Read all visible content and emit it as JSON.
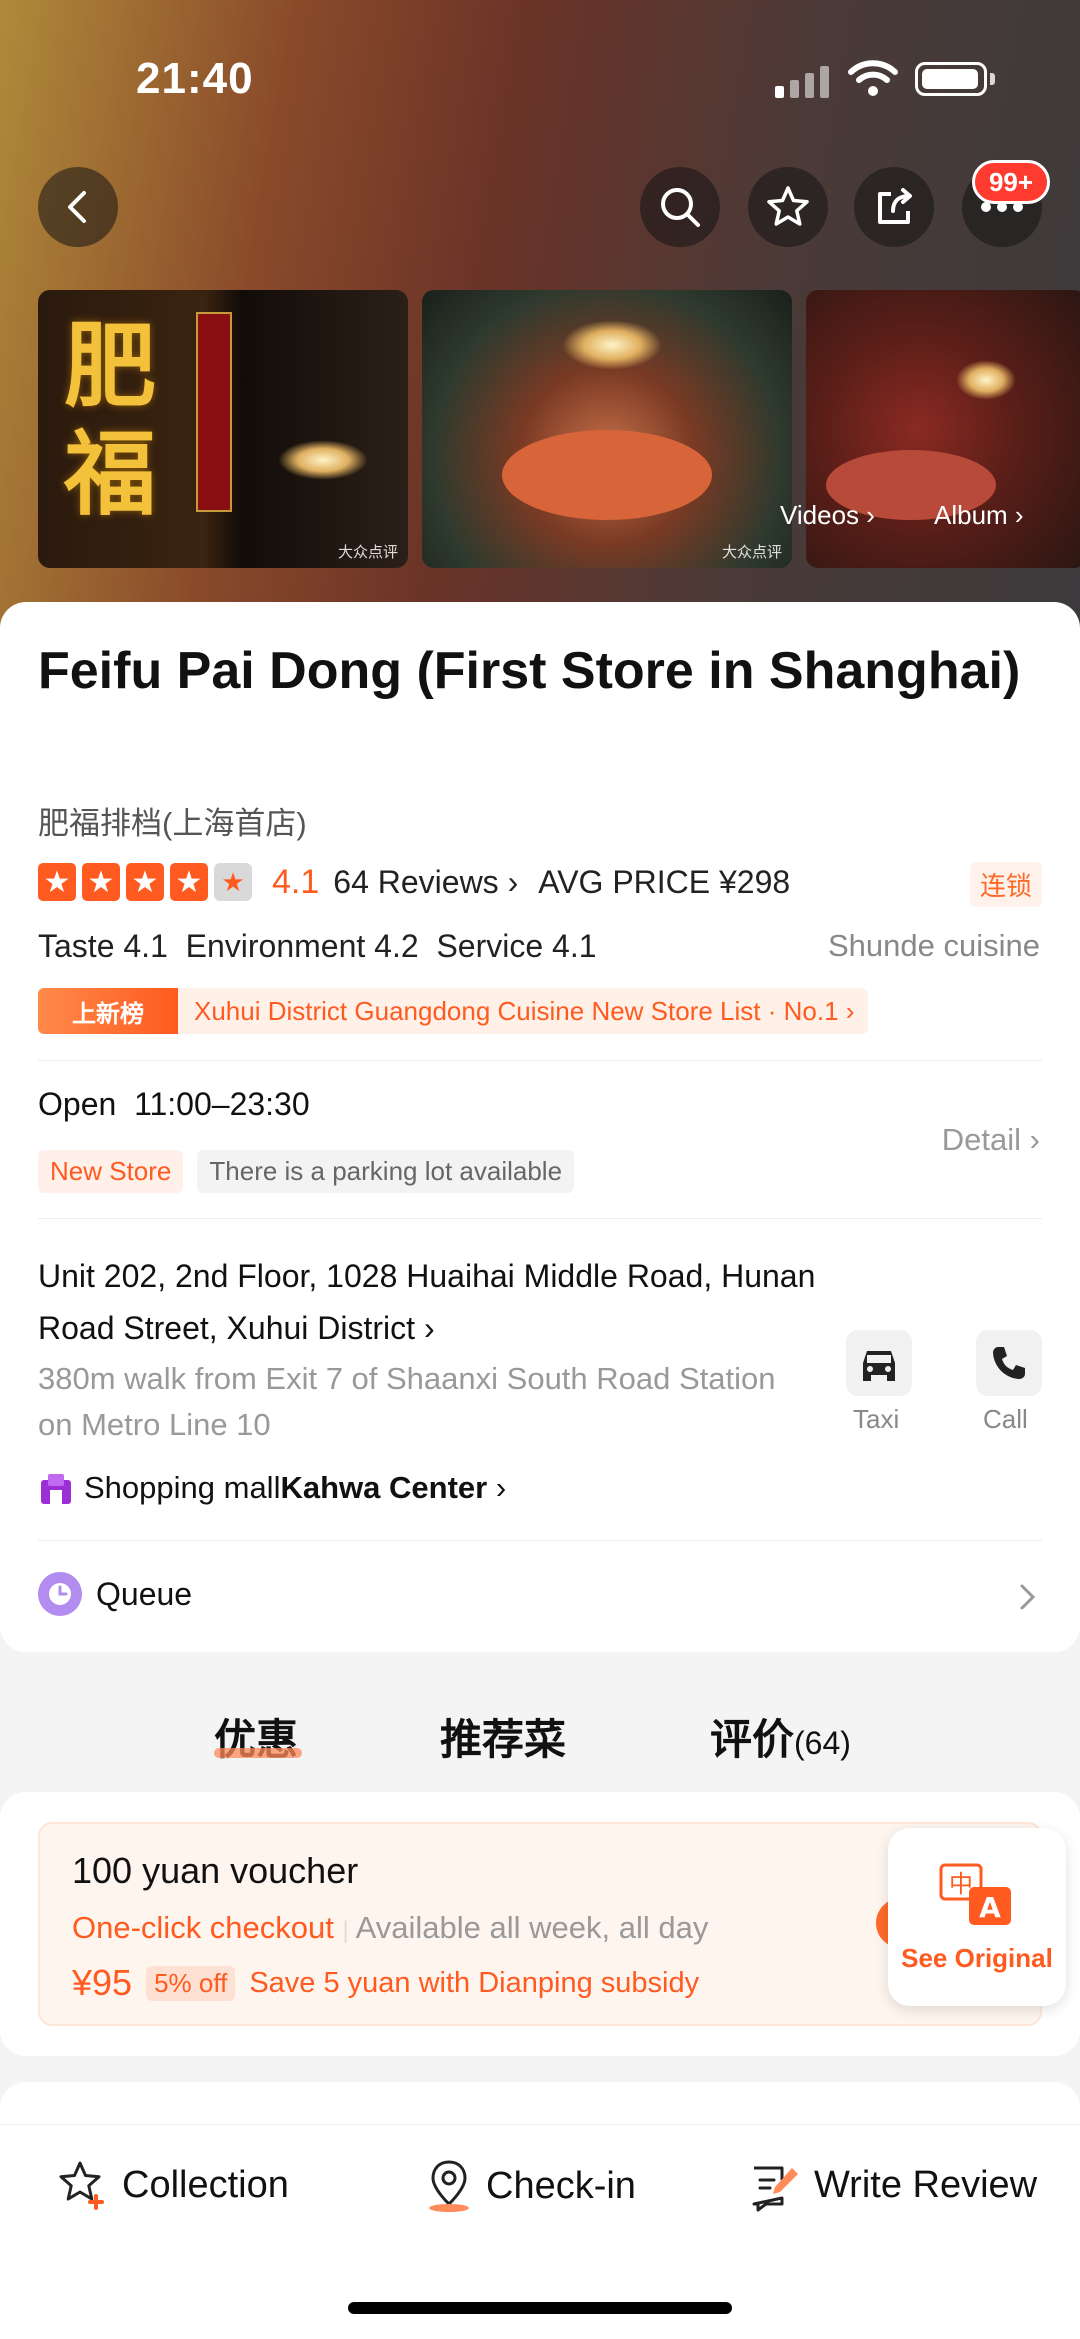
{
  "status_bar": {
    "time": "21:40"
  },
  "header": {
    "badge": "99+"
  },
  "gallery": {
    "videos_label": "Videos",
    "album_label": "Album",
    "watermark": "大众点评",
    "sign_text": "肥福"
  },
  "shop": {
    "name": "Feifu Pai Dong (First Store in Shanghai)",
    "name_original": "肥福排档(上海首店)",
    "rating": "4.1",
    "stars": 4,
    "reviews": "64 Reviews",
    "avg_price": "AVG PRICE ¥298",
    "chain_tag": "连锁",
    "scores": "Taste 4.1  Environment 4.2  Service 4.1",
    "cuisine": "Shunde cuisine",
    "rank_tag": "上新榜",
    "rank_text": "Xuhui District Guangdong Cuisine New Store List · No.1"
  },
  "hours": {
    "label": "Open  11:00–23:30",
    "tag_new": "New Store",
    "tag_parking": "There is a parking lot available",
    "detail": "Detail"
  },
  "address": {
    "line": "Unit 202, 2nd Floor, 1028 Huaihai Middle Road, Hunan Road Street, Xuhui District",
    "walk": "380m walk from Exit 7 of Shaanxi South Road Station on Metro Line 10",
    "mall_prefix": "Shopping mall",
    "mall_name": "Kahwa Center",
    "taxi": "Taxi",
    "call": "Call"
  },
  "queue": {
    "label": "Queue"
  },
  "tabs": [
    {
      "label": "优惠"
    },
    {
      "label": "推荐菜"
    },
    {
      "label": "评价",
      "count": "(64)"
    }
  ],
  "deal": {
    "title": "100 yuan voucher",
    "checkout": "One-click checkout",
    "sep": "|",
    "availability": "Available all week, all day",
    "price": "¥95",
    "discount": "5% off",
    "subsidy": "Save 5 yuan with Dianping subsidy",
    "see_original": "See Original",
    "translate_zh": "中",
    "translate_en": "A"
  },
  "bottom_bar": {
    "collection": "Collection",
    "checkin": "Check-in",
    "review": "Write Review"
  },
  "colors": {
    "accent": "#ff5a1f",
    "star_off": "#d9d9d9",
    "queue_icon": "#b38cf0",
    "mall_icon": "#9b2fd6"
  }
}
